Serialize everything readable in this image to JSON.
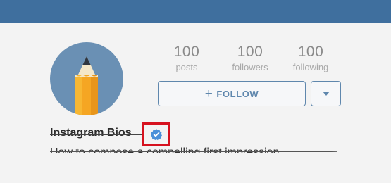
{
  "profile": {
    "name": "Instagram Bios",
    "bio": "How to compose a compelling first impression",
    "avatar_icon": "pencil-icon",
    "verified_icon": "verified-badge-icon"
  },
  "stats": {
    "posts": {
      "value": "100",
      "label": "posts"
    },
    "followers": {
      "value": "100",
      "label": "followers"
    },
    "following": {
      "value": "100",
      "label": "following"
    }
  },
  "actions": {
    "follow_label": "FOLLOW",
    "follow_icon": "plus-icon",
    "dropdown_icon": "caret-down-icon"
  },
  "colors": {
    "header": "#3f6f9e",
    "accent": "#5f87ad",
    "highlight": "#d6121f",
    "verified": "#4a90d9"
  }
}
